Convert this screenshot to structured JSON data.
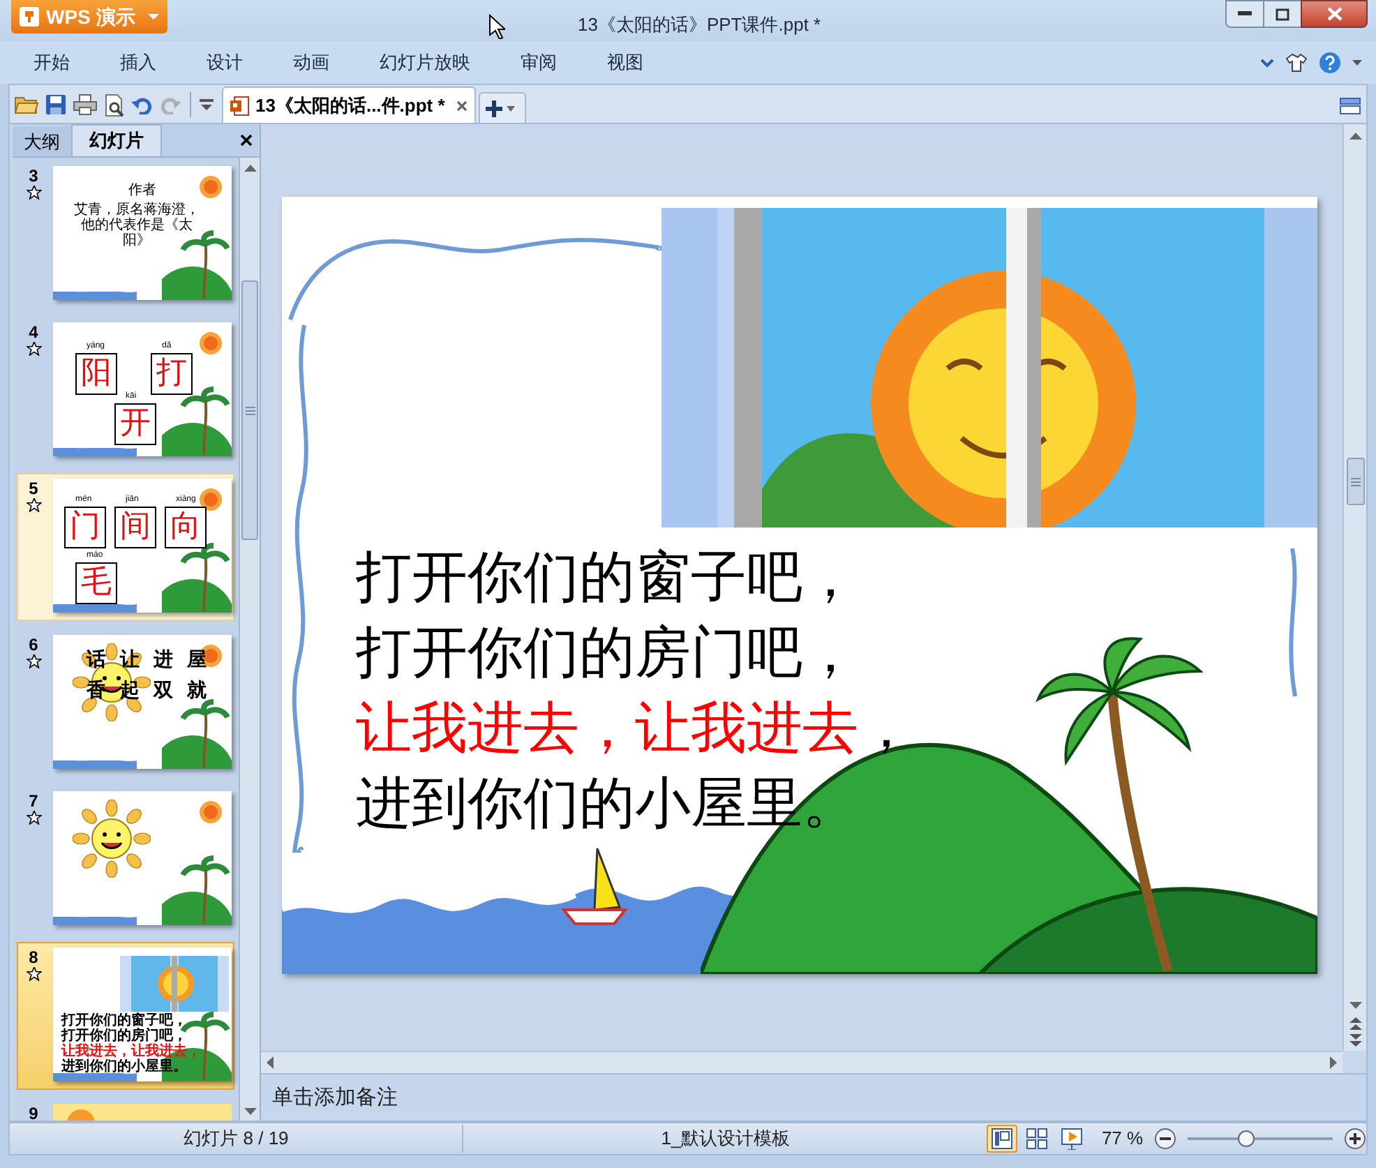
{
  "app_button": {
    "label": "WPS 演示"
  },
  "window": {
    "title": "13《太阳的话》PPT课件.ppt *"
  },
  "menu": [
    "开始",
    "插入",
    "设计",
    "动画",
    "幻灯片放映",
    "审阅",
    "视图"
  ],
  "document_tabs": [
    {
      "label": "13《太阳的话...件.ppt *",
      "selected": true
    }
  ],
  "panel_tabs": [
    {
      "label": "大纲",
      "selected": false
    },
    {
      "label": "幻灯片",
      "selected": true
    }
  ],
  "slides": [
    {
      "number": "3",
      "kind": "text",
      "selected": false,
      "highlighted": false,
      "title": "作者",
      "body": "艾青，原名蒋海澄，他的代表作是《太阳》"
    },
    {
      "number": "4",
      "kind": "characters",
      "selected": false,
      "highlighted": false,
      "chars": [
        {
          "char": "阳",
          "pinyin": "yáng"
        },
        {
          "char": "打",
          "pinyin": "dǎ"
        },
        {
          "char": "开",
          "pinyin": "kāi"
        }
      ]
    },
    {
      "number": "5",
      "kind": "characters",
      "selected": false,
      "highlighted": true,
      "chars": [
        {
          "char": "门",
          "pinyin": "mén"
        },
        {
          "char": "间",
          "pinyin": "jiān"
        },
        {
          "char": "向",
          "pinyin": "xiàng"
        },
        {
          "char": "毛",
          "pinyin": "máo"
        }
      ]
    },
    {
      "number": "6",
      "kind": "words",
      "selected": false,
      "highlighted": false,
      "chars": [
        "话",
        "让",
        "进",
        "屋",
        "香",
        "起",
        "双",
        "就"
      ]
    },
    {
      "number": "7",
      "kind": "sun",
      "selected": false,
      "highlighted": false
    },
    {
      "number": "8",
      "kind": "lines",
      "selected": true,
      "highlighted": false,
      "lines": [
        "打开你们的窗子吧，",
        "打开你们的房门吧，",
        "让我进去，让我进去，",
        "进到你们的小屋里。"
      ]
    },
    {
      "number": "9",
      "kind": "partial",
      "selected": false,
      "highlighted": false
    }
  ],
  "slide_text": [
    [
      {
        "text": "打开你们的窗子吧，",
        "highlighted": false
      }
    ],
    [
      {
        "text": "打开你们的房门吧，",
        "highlighted": false
      }
    ],
    [
      {
        "text": "让我进去，让我进去",
        "highlighted": true
      },
      {
        "text": "，",
        "highlighted": false
      }
    ],
    [
      {
        "text": "进到你们的小屋里。",
        "highlighted": false
      }
    ]
  ],
  "notes": {
    "placeholder": "单击添加备注"
  },
  "status_bar": {
    "slide_counter": "幻灯片 8 / 19",
    "template": "1_默认设计模板",
    "views": [
      {
        "kind": "normal",
        "selected": true
      },
      {
        "kind": "sorter",
        "selected": false
      },
      {
        "kind": "show",
        "selected": false
      }
    ],
    "zoom": "77 %",
    "zoom_slider": {
      "level": 0.4
    }
  }
}
